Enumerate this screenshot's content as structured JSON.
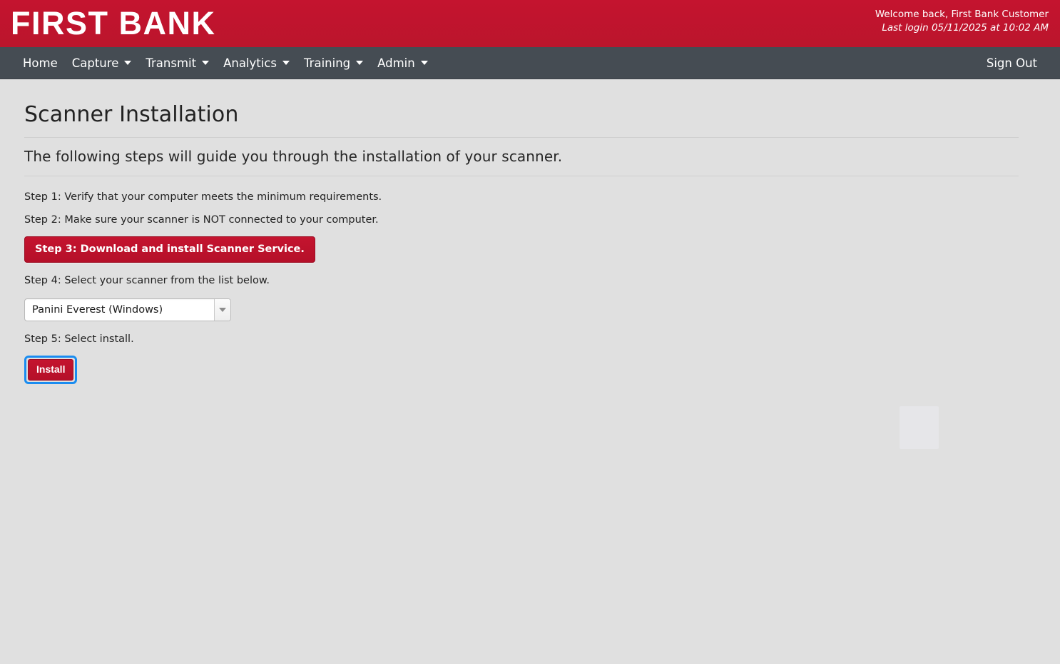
{
  "header": {
    "brand": "FIRST BANK",
    "welcome": "Welcome back, First Bank Customer",
    "last_login": "Last login 05/11/2025 at 10:02 AM",
    "brand_color": "#be1a2d"
  },
  "nav": {
    "bar_color": "#454c53",
    "items": [
      {
        "label": "Home",
        "has_caret": false
      },
      {
        "label": "Capture",
        "has_caret": true
      },
      {
        "label": "Transmit",
        "has_caret": true
      },
      {
        "label": "Analytics",
        "has_caret": true
      },
      {
        "label": "Training",
        "has_caret": true
      },
      {
        "label": "Admin",
        "has_caret": true
      }
    ],
    "sign_out": "Sign Out"
  },
  "page": {
    "title": "Scanner Installation",
    "subtitle": "The following steps will guide you through the installation of your scanner.",
    "step1": "Step 1: Verify that your computer meets the minimum requirements.",
    "step2": "Step 2: Make sure your scanner is NOT connected to your computer.",
    "step3_button": "Step 3: Download and install Scanner Service.",
    "step4": "Step 4: Select your scanner from the list below.",
    "step5": "Step 5: Select install.",
    "install_button": "Install"
  },
  "scanner_select": {
    "selected": "Panini Everest (Windows)",
    "focused": false
  },
  "install": {
    "focus_ring_color": "#1a8cf0",
    "button_color": "#bf1230"
  }
}
